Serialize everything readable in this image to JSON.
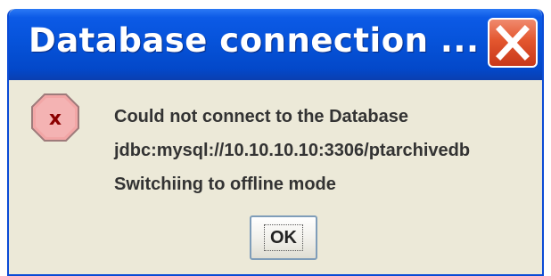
{
  "window": {
    "title": "Database connection ...",
    "close_icon": "close-icon"
  },
  "dialog": {
    "icon": "error-icon",
    "message_lines": [
      "Could not connect to the Database",
      "jdbc:mysql://10.10.10.10:3306/ptarchivedb",
      "Switchiing to offline mode"
    ],
    "ok_label": "OK"
  },
  "colors": {
    "titlebar": "#0653DA",
    "close_button": "#E3562E",
    "dialog_background": "#ECE9D8",
    "error_icon_fill": "#F2A0A0",
    "error_icon_glyph": "#8B0000"
  }
}
